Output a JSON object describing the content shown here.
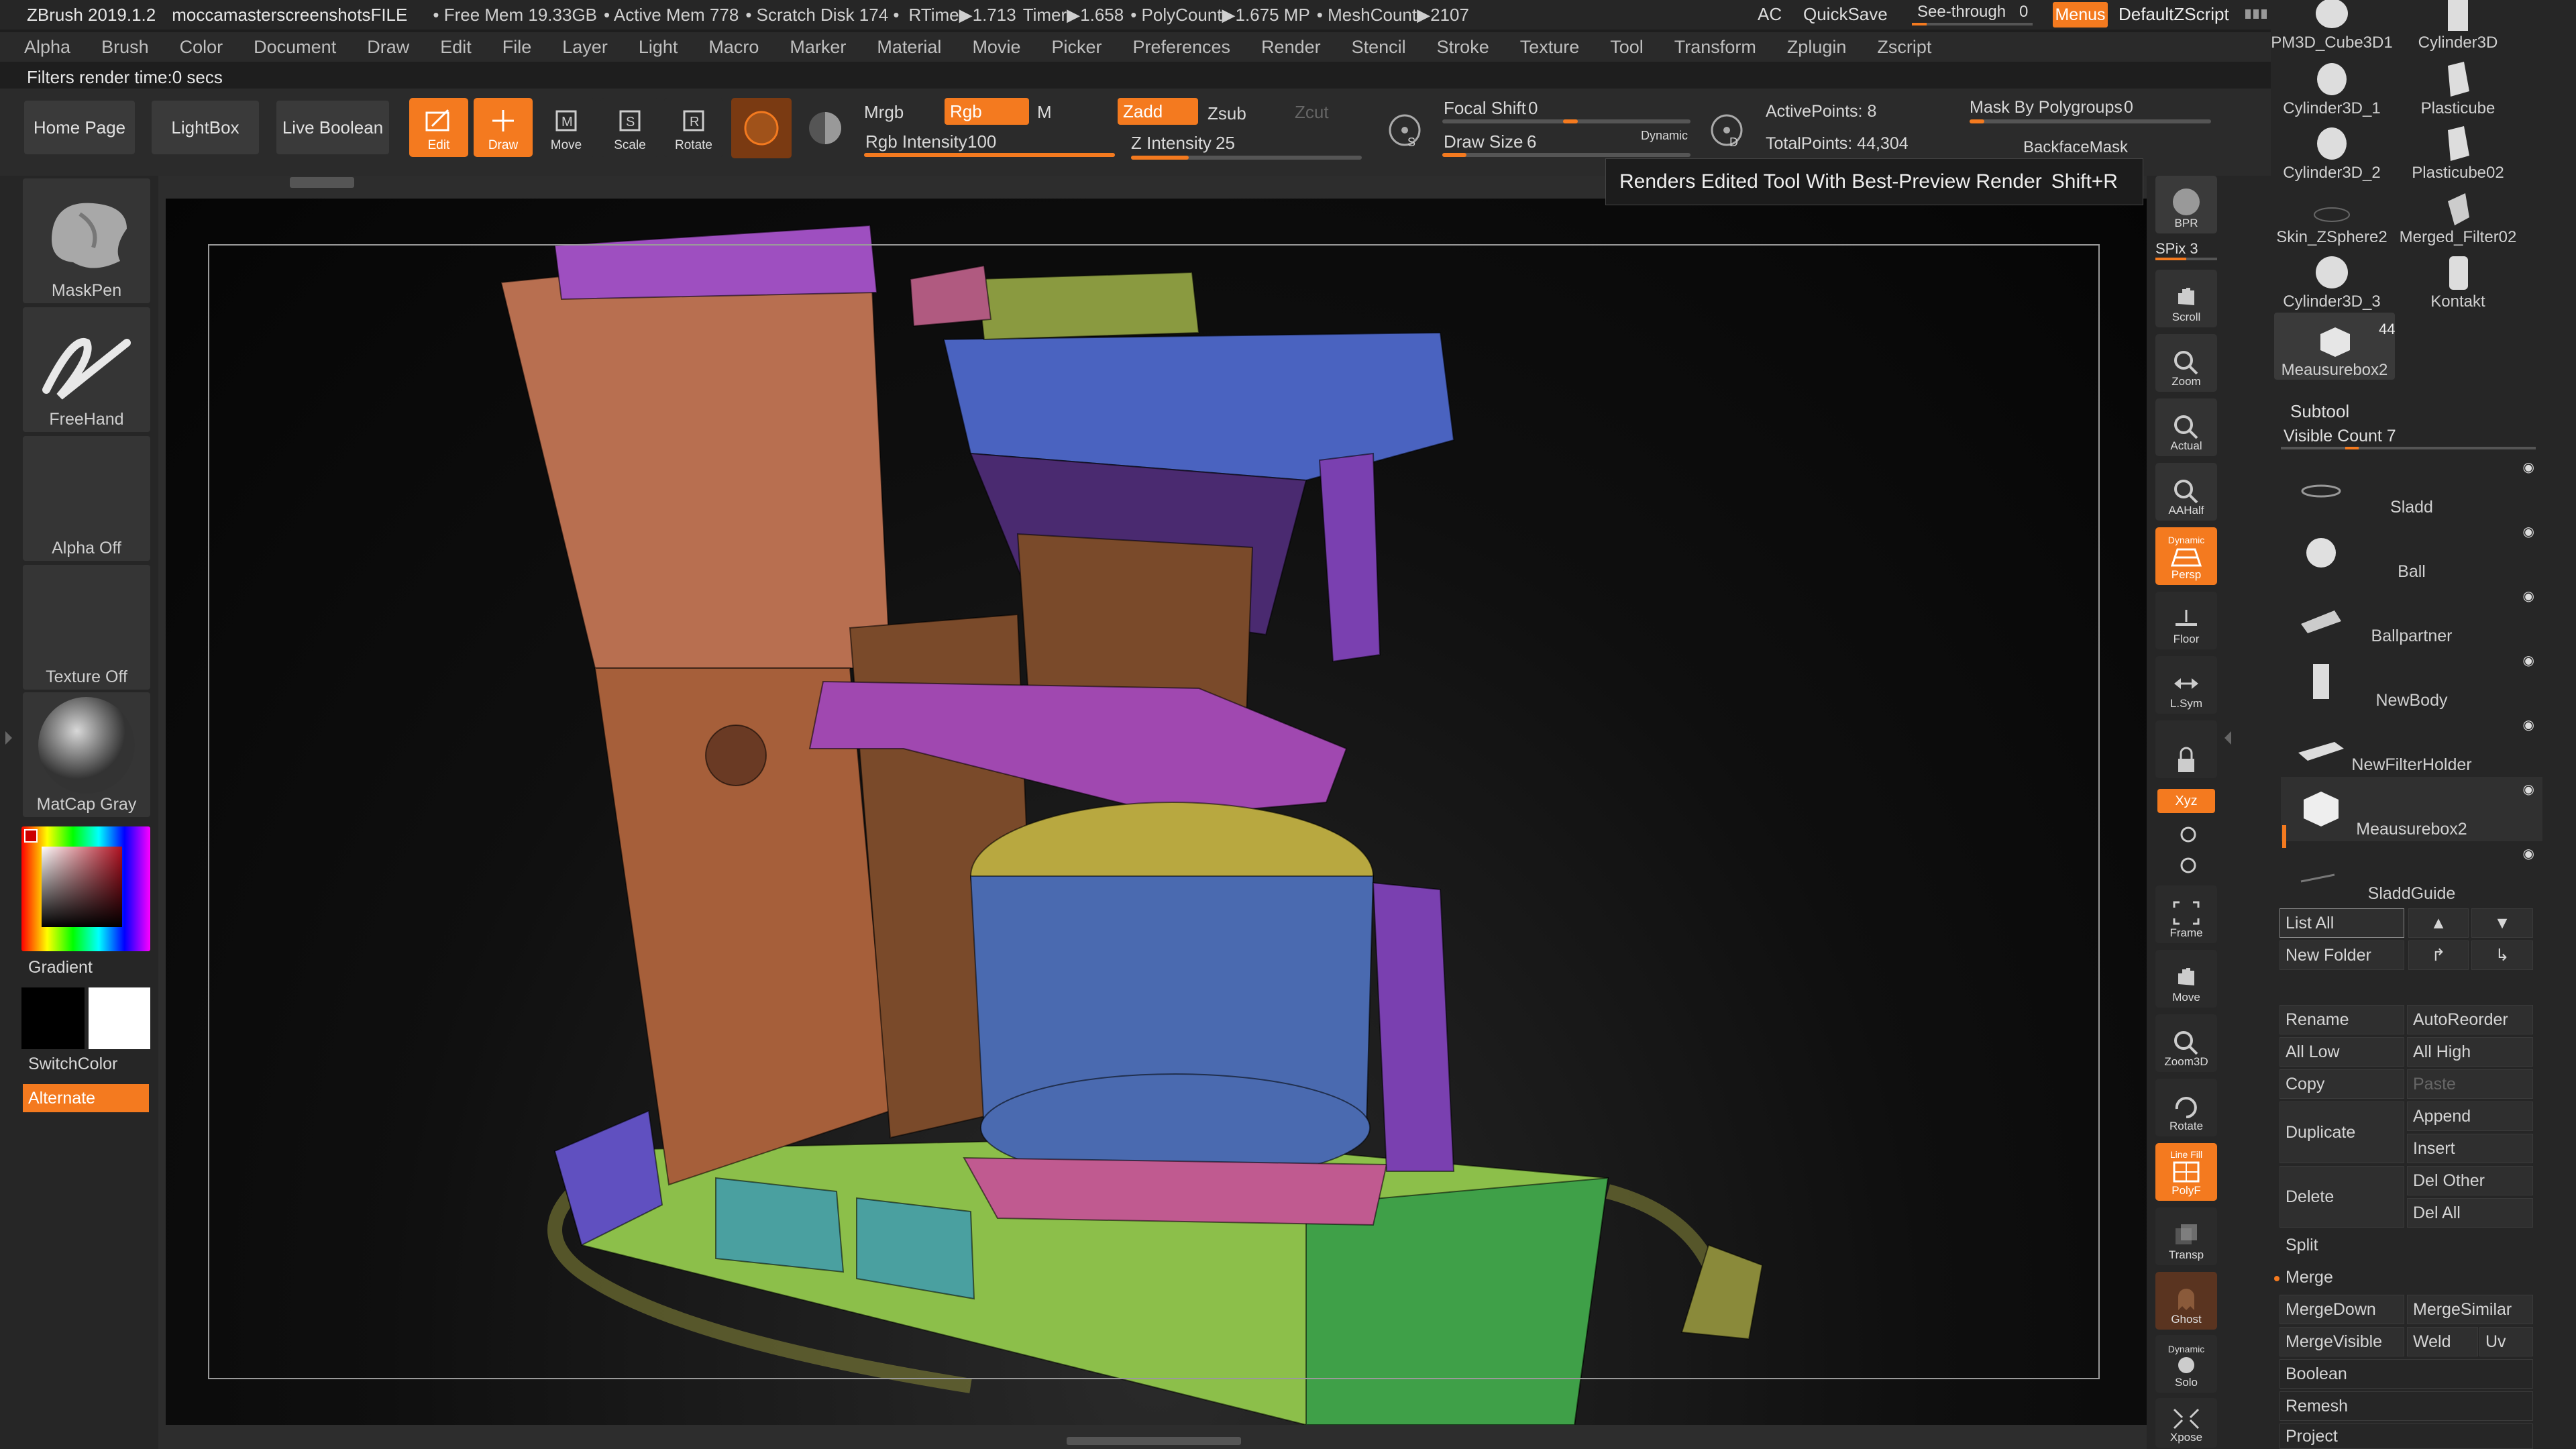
{
  "titlebar": {
    "app": "ZBrush 2019.1.2",
    "file": "moccamasterscreenshotsFILE",
    "free_mem": "• Free Mem 19.33GB",
    "active_mem": "• Active Mem 778",
    "scratch": "• Scratch Disk 174 •",
    "rtime": "RTime▶1.713",
    "timer": "Timer▶1.658",
    "polycount": "• PolyCount▶1.675 MP",
    "meshcount": "• MeshCount▶2107",
    "ac": "AC",
    "quicksave": "QuickSave",
    "seethrough": "See-through",
    "seethrough_value": "0",
    "menus": "Menus",
    "script": "DefaultZScript"
  },
  "menubar": [
    "Alpha",
    "Brush",
    "Color",
    "Document",
    "Draw",
    "Edit",
    "File",
    "Layer",
    "Light",
    "Macro",
    "Marker",
    "Material",
    "Movie",
    "Picker",
    "Preferences",
    "Render",
    "Stencil",
    "Stroke",
    "Texture",
    "Tool",
    "Transform",
    "Zplugin",
    "Zscript"
  ],
  "status": "Filters render time:0 secs",
  "toolbar": {
    "home": "Home Page",
    "lightbox": "LightBox",
    "liveboolean": "Live Boolean",
    "edit": "Edit",
    "draw": "Draw",
    "move": "Move",
    "scale": "Scale",
    "rotate": "Rotate",
    "mrgb": "Mrgb",
    "rgb": "Rgb",
    "m": "M",
    "rgb_intensity_label": "Rgb Intensity",
    "rgb_intensity": 100,
    "zadd": "Zadd",
    "zsub": "Zsub",
    "zcut": "Zcut",
    "z_intensity_label": "Z Intensity",
    "z_intensity": 25,
    "focal_label": "Focal Shift",
    "focal": 0,
    "drawsize_label": "Draw Size",
    "drawsize": 6,
    "dynamic": "Dynamic",
    "active_points": "ActivePoints: 8",
    "total_points": "TotalPoints: 44,304",
    "mask_polygroups": "Mask By Polygroups",
    "mask_polygroups_value": 0,
    "backface": "BackfaceMask"
  },
  "tooltip": {
    "text": "Renders Edited Tool With Best-Preview Render",
    "shortcut": "Shift+R"
  },
  "leftshelf": {
    "brush": "MaskPen",
    "stroke": "FreeHand",
    "alpha": "Alpha Off",
    "texture": "Texture Off",
    "material": "MatCap Gray",
    "gradient": "Gradient",
    "switchcolor": "SwitchColor",
    "alternate": "Alternate"
  },
  "rightshelf": [
    "BPR",
    "Scroll",
    "Zoom",
    "Actual",
    "AAHalf",
    "Persp",
    "Floor",
    "L.Sym",
    "",
    "Xyz",
    "",
    "",
    "Frame",
    "Move",
    "Zoom3D",
    "Rotate",
    "PolyF",
    "Transp",
    "Ghost",
    "Solo",
    "Xpose"
  ],
  "rightshelf_extra": {
    "spix": "SPix 3",
    "dynamic": "Dynamic",
    "linefill": "Line Fill"
  },
  "tools": [
    {
      "name": "PM3D_Cube3D1",
      "col": 0
    },
    {
      "name": "Cylinder3D",
      "col": 1
    },
    {
      "name": "Cylinder3D_1",
      "col": 0
    },
    {
      "name": "Plasticube",
      "col": 1
    },
    {
      "name": "Cylinder3D_2",
      "col": 0
    },
    {
      "name": "Plasticube02",
      "col": 1
    },
    {
      "name": "Skin_ZSphere2",
      "col": 0
    },
    {
      "name": "Merged_Filter02",
      "col": 1
    },
    {
      "name": "Cylinder3D_3",
      "col": 0
    },
    {
      "name": "Kontakt",
      "col": 1
    },
    {
      "name": "Meausurebox2",
      "col": 0
    }
  ],
  "tools_count": "44",
  "subtool": {
    "title": "Subtool",
    "visible_count": "Visible Count 7",
    "items": [
      "Sladd",
      "Ball",
      "Ballpartner",
      "NewBody",
      "NewFilterHolder",
      "Meausurebox2",
      "SladdGuide"
    ]
  },
  "buttons": {
    "listall": "List All",
    "newfolder": "New Folder",
    "rename": "Rename",
    "autoreorder": "AutoReorder",
    "alllow": "All Low",
    "allhigh": "All High",
    "copy": "Copy",
    "paste": "Paste",
    "duplicate": "Duplicate",
    "append": "Append",
    "insert": "Insert",
    "delete": "Delete",
    "delother": "Del Other",
    "delall": "Del All",
    "split": "Split",
    "merge": "Merge",
    "mergedown": "MergeDown",
    "mergesimilar": "MergeSimilar",
    "mergevisible": "MergeVisible",
    "weld": "Weld",
    "uv": "Uv",
    "boolean": "Boolean",
    "remesh": "Remesh",
    "project": "Project"
  },
  "colors": {
    "accent": "#f47a1f",
    "bg": "#1e1e1e",
    "panel": "#2b2b2b"
  }
}
